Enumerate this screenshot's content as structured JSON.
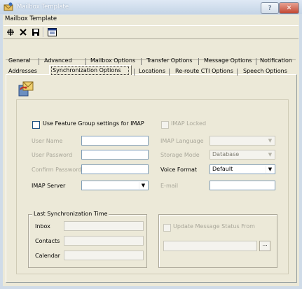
{
  "window": {
    "title": "Mailbox Template",
    "subtitle": "Mailbox Template",
    "help_glyph": "?",
    "close_glyph": "✕",
    "app_icon": "mailbox-icon"
  },
  "toolbar": {
    "buttons": [
      {
        "icon": "add-icon",
        "glyph": "+"
      },
      {
        "icon": "delete-icon",
        "glyph": "✕"
      },
      {
        "icon": "save-icon",
        "glyph": "▣"
      },
      {
        "icon": "properties-icon",
        "glyph": "▤"
      }
    ]
  },
  "tabs": {
    "row1": [
      "General",
      "Advanced",
      "Mailbox Options",
      "Transfer Options",
      "Message Options",
      "Notification"
    ],
    "row2": [
      "Addresses",
      "Synchronization Options",
      "Locations",
      "Re-route CTI Options",
      "Speech Options"
    ],
    "active": "Synchronization Options"
  },
  "sync": {
    "use_feature_group_label": "Use Feature Group settings for IMAP",
    "imap_locked_label": "IMAP Locked",
    "user_name_label": "User Name",
    "user_password_label": "User Password",
    "confirm_password_label": "Confirm Password",
    "imap_server_label": "IMAP Server",
    "imap_language_label": "IMAP Language",
    "storage_mode_label": "Storage Mode",
    "storage_mode_value": "Database",
    "voice_format_label": "Voice Format",
    "voice_format_value": "Default",
    "email_label": "E-mail",
    "last_sync_legend": "Last Synchronization Time",
    "inbox_label": "Inbox",
    "contacts_label": "Contacts",
    "calendar_label": "Calendar",
    "update_status_label": "Update Message Status From",
    "browse_label": "..."
  },
  "colors": {
    "dialog_bg": "#ece9d8",
    "titlebar_blue": "#c4d4e6",
    "close_red": "#c24732",
    "disabled_text": "#a9a79a"
  }
}
